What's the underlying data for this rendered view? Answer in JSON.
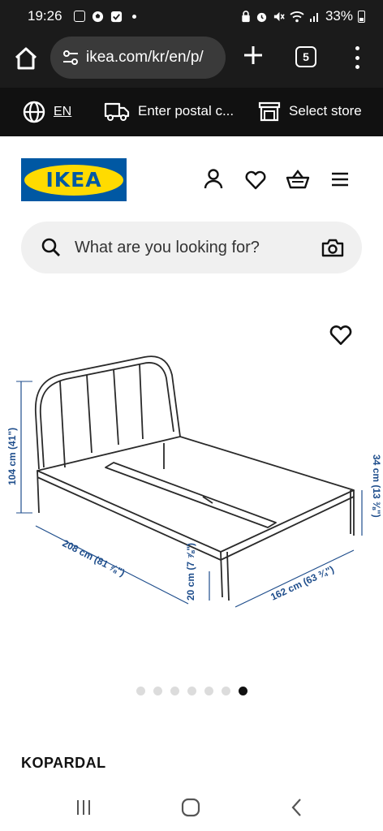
{
  "status_bar": {
    "time": "19:26",
    "battery_pct": "33%"
  },
  "browser": {
    "url": "ikea.com/kr/en/p/",
    "tab_count": "5"
  },
  "ikea_strip": {
    "language": "EN",
    "postal": "Enter postal c...",
    "store": "Select store"
  },
  "header": {
    "logo_text": "IKEA"
  },
  "search": {
    "placeholder": "What are you looking for?"
  },
  "product_image": {
    "dimensions": {
      "height_total": "104 cm (41\")",
      "length": "208 cm (81 ⅞\")",
      "leg_height": "20 cm (7 ⅞\")",
      "width": "162 cm (63 ¾\")",
      "frame_height": "34 cm (13 ⅜\")"
    }
  },
  "carousel": {
    "count": 7,
    "active_index": 6
  },
  "product": {
    "name": "KOPARDAL"
  },
  "colors": {
    "dark_bar": "#1b1b1b",
    "strip": "#111111",
    "ikea_blue": "#0058a3",
    "ikea_yellow": "#ffdb00",
    "dimension_blue": "#1f4e8c"
  }
}
